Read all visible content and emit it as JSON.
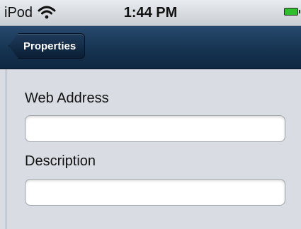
{
  "status_bar": {
    "carrier": "iPod",
    "wifi_icon": "wifi-icon",
    "time": "1:44 PM",
    "battery_icon": "battery-icon",
    "battery_color": "#2ebe2e"
  },
  "nav_bar": {
    "back_label": "Properties"
  },
  "form": {
    "web_address_label": "Web Address",
    "web_address_value": "",
    "description_label": "Description",
    "description_value": ""
  }
}
